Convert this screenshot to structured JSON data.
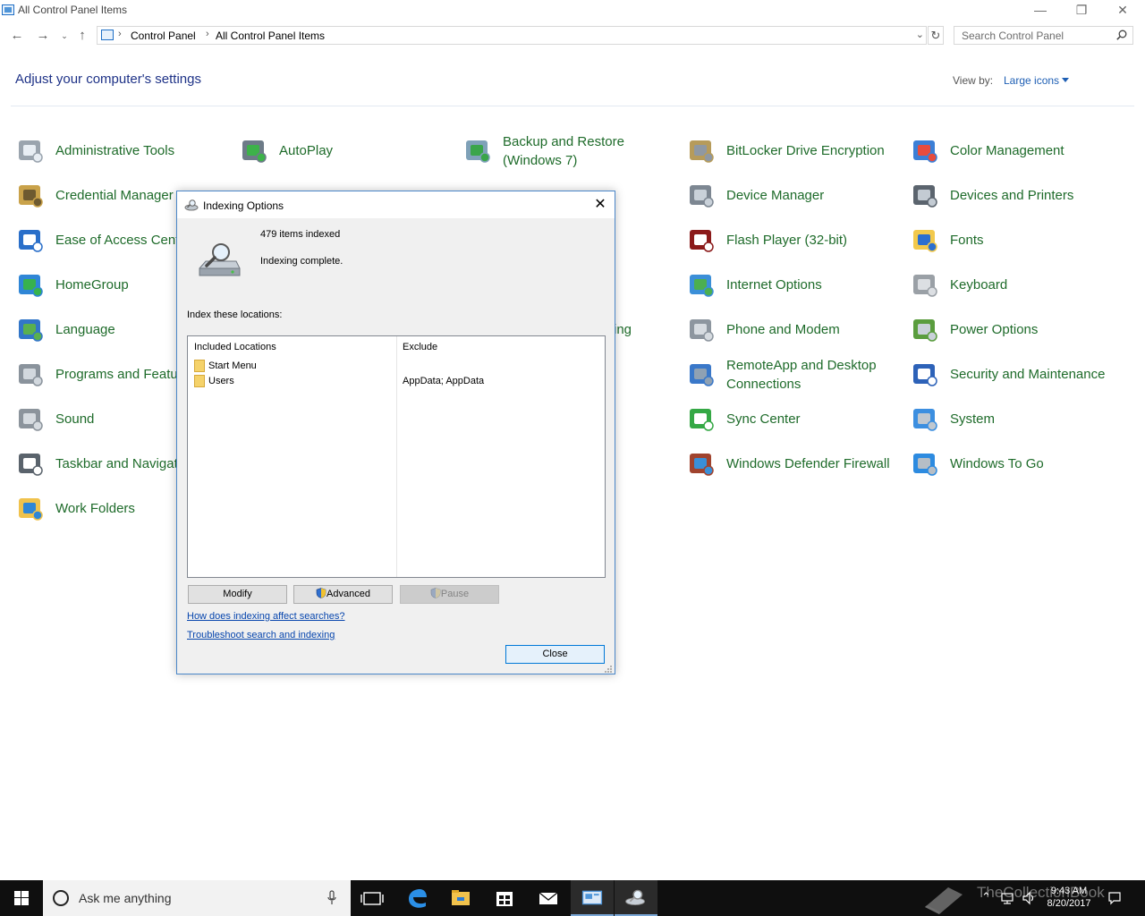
{
  "window": {
    "title": "All Control Panel Items",
    "minimize_glyph": "—",
    "restore_glyph": "❐",
    "close_glyph": "✕"
  },
  "addressbar": {
    "crumbs": [
      "Control Panel",
      "All Control Panel Items"
    ],
    "search_placeholder": "Search Control Panel"
  },
  "header": {
    "title": "Adjust your computer's settings",
    "view_by_label": "View by:",
    "view_by_value": "Large icons"
  },
  "items": [
    {
      "label": "Administrative Tools",
      "icon": "admin-tools-icon"
    },
    {
      "label": "AutoPlay",
      "icon": "autoplay-icon"
    },
    {
      "label": "Backup and Restore (Windows 7)",
      "icon": "backup-icon"
    },
    {
      "label": "BitLocker Drive Encryption",
      "icon": "bitlocker-icon"
    },
    {
      "label": "Color Management",
      "icon": "color-management-icon"
    },
    {
      "label": "Credential Manager",
      "icon": "credential-manager-icon"
    },
    {
      "label": "Device Manager",
      "icon": "device-manager-icon"
    },
    {
      "label": "Devices and Printers",
      "icon": "printer-icon"
    },
    {
      "label": "Ease of Access Center",
      "icon": "ease-of-access-icon"
    },
    {
      "label": "Flash Player (32-bit)",
      "icon": "flash-player-icon"
    },
    {
      "label": "Fonts",
      "icon": "fonts-icon"
    },
    {
      "label": "HomeGroup",
      "icon": "homegroup-icon"
    },
    {
      "label": "Internet Options",
      "icon": "internet-options-icon"
    },
    {
      "label": "Keyboard",
      "icon": "keyboard-icon"
    },
    {
      "label": "Language",
      "icon": "language-icon"
    },
    {
      "label": "ing",
      "icon": "hidden-item"
    },
    {
      "label": "Phone and Modem",
      "icon": "phone-modem-icon"
    },
    {
      "label": "Power Options",
      "icon": "power-options-icon"
    },
    {
      "label": "Programs and Features",
      "icon": "programs-icon"
    },
    {
      "label": "RemoteApp and Desktop Connections",
      "icon": "remoteapp-icon"
    },
    {
      "label": "Security and Maintenance",
      "icon": "security-flag-icon"
    },
    {
      "label": "Sound",
      "icon": "sound-icon"
    },
    {
      "label": "Sync Center",
      "icon": "sync-center-icon"
    },
    {
      "label": "System",
      "icon": "system-icon"
    },
    {
      "label": "Taskbar and Navigation",
      "icon": "taskbar-nav-icon"
    },
    {
      "label": "Windows Defender Firewall",
      "icon": "firewall-icon"
    },
    {
      "label": "Windows To Go",
      "icon": "windows-to-go-icon"
    },
    {
      "label": "Work Folders",
      "icon": "work-folders-icon"
    }
  ],
  "dialog": {
    "title": "Indexing Options",
    "items_indexed": "479 items indexed",
    "status": "Indexing complete.",
    "index_label": "Index these locations:",
    "columns": {
      "included": "Included Locations",
      "exclude": "Exclude"
    },
    "locations": [
      {
        "name": "Start Menu",
        "exclude": ""
      },
      {
        "name": "Users",
        "exclude": "AppData; AppData"
      }
    ],
    "buttons": {
      "modify": "Modify",
      "advanced": "Advanced",
      "pause": "Pause",
      "close": "Close"
    },
    "links": {
      "how": "How does indexing affect searches?",
      "troubleshoot": "Troubleshoot search and indexing"
    }
  },
  "taskbar": {
    "search_text": "Ask me anything",
    "time": "9:43 AM",
    "date": "8/20/2017",
    "watermark": "TheCollectionBook"
  }
}
